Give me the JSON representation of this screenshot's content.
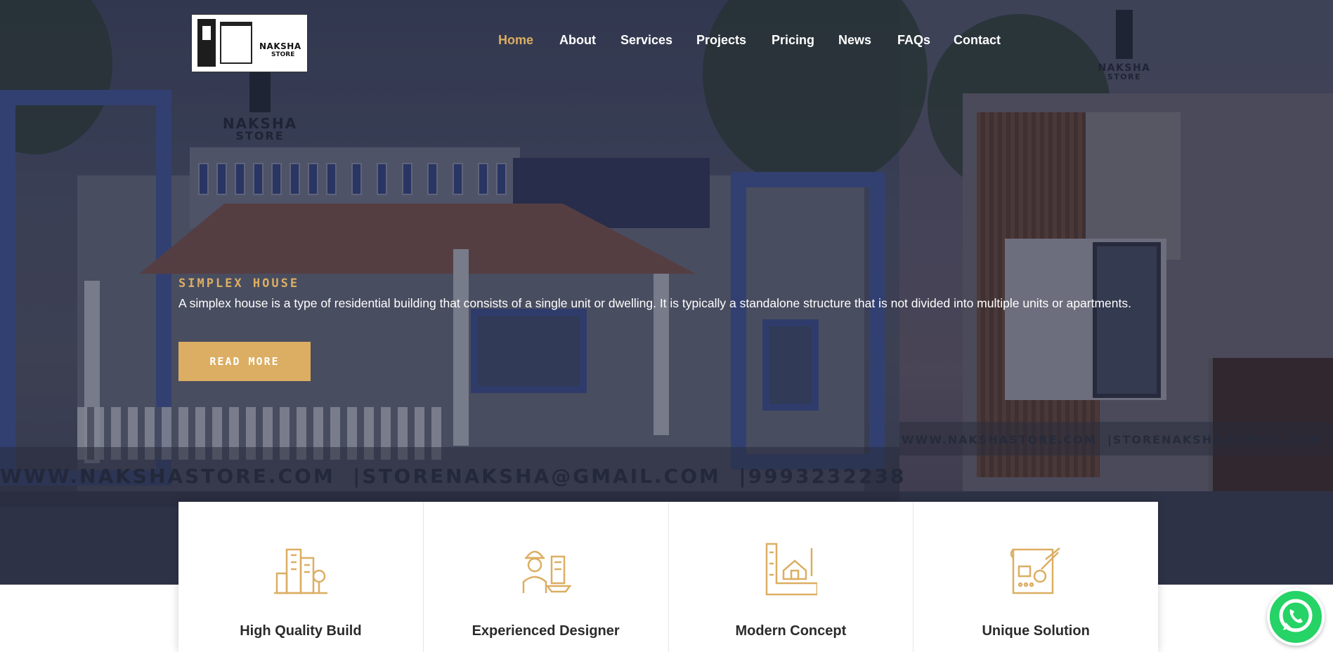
{
  "brand": {
    "name": "NAKSHA",
    "sub": "STORE"
  },
  "nav": {
    "items": [
      "Home",
      "About",
      "Services",
      "Projects",
      "Pricing",
      "News",
      "FAQs",
      "Contact"
    ],
    "active": "Home"
  },
  "hero": {
    "kicker": "SIMPLEX HOUSE",
    "description": "A simplex house is a type of residential building that consists of a single unit or dwelling. It is typically a standalone structure that is not divided into multiple units or apartments.",
    "button_label": "READ MORE",
    "watermark": "WWW.NAKSHASTORE.COM  |STORENAKSHA@GMAIL.COM  |9993232238",
    "watermark_right": "WWW.NAKSHASTORE.COM  |STORENAKSHA@GMAIL.COM  |S"
  },
  "features": [
    {
      "label": "High Quality Build",
      "icon": "buildings-icon"
    },
    {
      "label": "Experienced Designer",
      "icon": "engineer-icon"
    },
    {
      "label": "Modern Concept",
      "icon": "blueprint-house-icon"
    },
    {
      "label": "Unique Solution",
      "icon": "plan-drawing-icon"
    }
  ],
  "colors": {
    "accent": "#dcae63",
    "whatsapp": "#25d366",
    "overlay": "#2a3150"
  }
}
